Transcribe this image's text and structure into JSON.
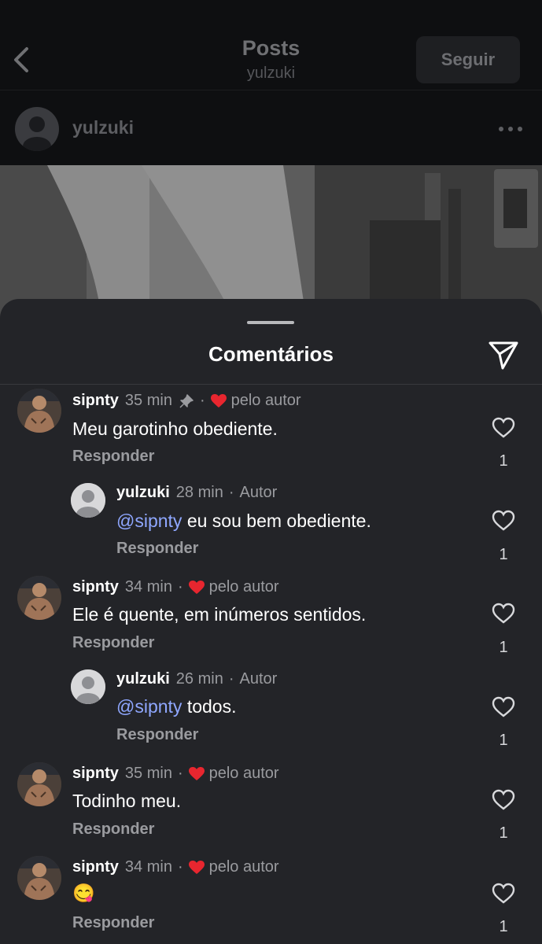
{
  "header": {
    "title": "Posts",
    "subtitle": "yulzuki",
    "follow_label": "Seguir"
  },
  "author": {
    "name": "yulzuki"
  },
  "sheet": {
    "title": "Comentários"
  },
  "comments": [
    {
      "user": "sipnty",
      "time": "35 min",
      "pinned": true,
      "liked_label": "pelo autor",
      "text": "Meu garotinho obediente.",
      "reply_label": "Responder",
      "likes": "1"
    },
    {
      "user": "yulzuki",
      "time": "28 min",
      "author_label": "Autor",
      "mention": "@sipnty",
      "text": " eu sou bem obediente.",
      "reply_label": "Responder",
      "likes": "1"
    },
    {
      "user": "sipnty",
      "time": "34 min",
      "liked_label": "pelo autor",
      "text": "Ele é quente, em inúmeros sentidos.",
      "reply_label": "Responder",
      "likes": "1"
    },
    {
      "user": "yulzuki",
      "time": "26 min",
      "author_label": "Autor",
      "mention": "@sipnty",
      "text": " todos.",
      "reply_label": "Responder",
      "likes": "1"
    },
    {
      "user": "sipnty",
      "time": "35 min",
      "liked_label": "pelo autor",
      "text": "Todinho meu.",
      "reply_label": "Responder",
      "likes": "1"
    },
    {
      "user": "sipnty",
      "time": "34 min",
      "liked_label": "pelo autor",
      "text": "😋",
      "reply_label": "Responder",
      "likes": "1"
    }
  ],
  "icons": {
    "back": "chevron-left-icon",
    "more": "more-horizontal-icon",
    "share": "send-icon",
    "like": "heart-outline-icon",
    "liked_by_author": "heart-filled-icon",
    "pin": "pin-icon"
  },
  "colors": {
    "mention": "#8fa7ff",
    "heart": "#e8262f",
    "sheet_bg": "#232428"
  }
}
